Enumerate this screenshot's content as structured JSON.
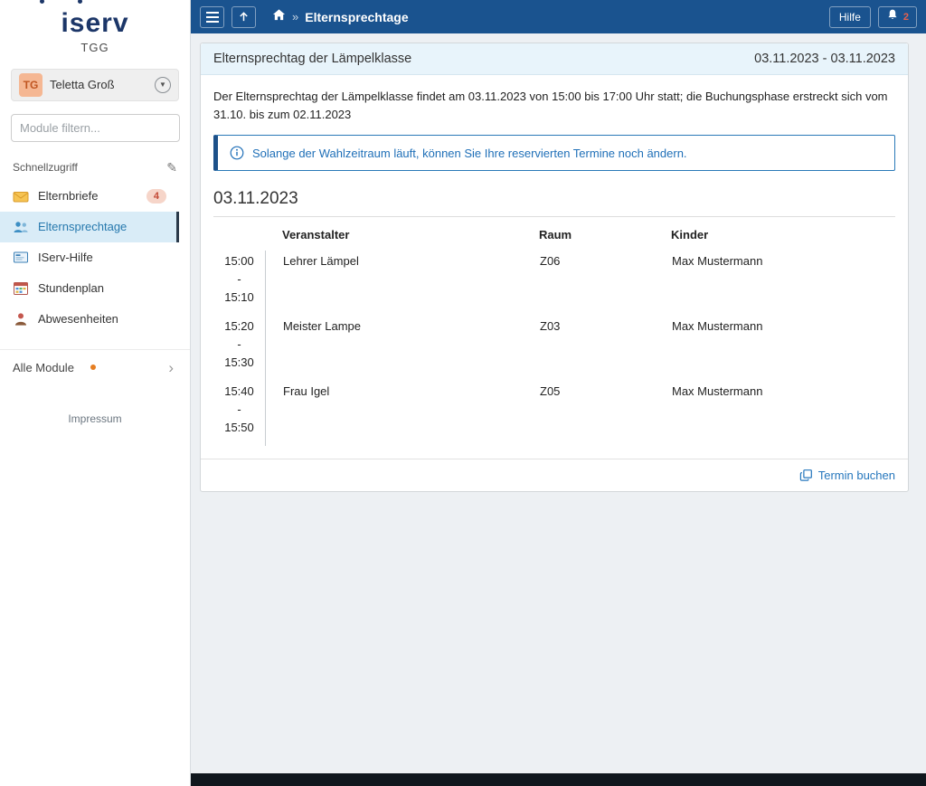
{
  "theme": {
    "header_bg": "#1a538f",
    "active_item_bg": "#d9ecf7",
    "link_color": "#2677bd",
    "alert_text": "#2070b8",
    "badge_bg": "#f6d5c9",
    "badge_text": "#c34a36",
    "footer_bar_bg": "#10171d"
  },
  "sidebar": {
    "logo_text": "iserv",
    "org_label": "TGG",
    "user": {
      "initials": "TG",
      "name": "Teletta Groß",
      "chevron_icon": "▼"
    },
    "filter_placeholder": "Module filtern...",
    "quick_access_label": "Schnellzugriff",
    "edit_icon": "✎",
    "items": [
      {
        "label": "Elternbriefe",
        "badge": "4",
        "icon": "letters-icon"
      },
      {
        "label": "Elternsprechtage",
        "icon": "people-icon"
      },
      {
        "label": "IServ-Hilfe",
        "icon": "help-screen-icon"
      },
      {
        "label": "Stundenplan",
        "icon": "timetable-icon"
      },
      {
        "label": "Abwesenheiten",
        "icon": "absence-icon"
      }
    ],
    "all_modules": {
      "label": "Alle Module",
      "chevron_icon": "›"
    },
    "impressum_label": "Impressum"
  },
  "header": {
    "breadcrumb_separator": "»",
    "title": "Elternsprechtage",
    "help_label": "Hilfe",
    "notification_count": "2"
  },
  "main": {
    "panel": {
      "title": "Elternsprechtag der Lämpelklasse",
      "date_range": "03.11.2023 - 03.11.2023",
      "description": "Der Elternsprechtag der Lämpelklasse findet am 03.11.2023 von 15:00 bis 17:00 Uhr statt; die Buchungsphase erstreckt sich vom 31.10. bis zum 02.11.2023",
      "info_alert": "Solange der Wahlzeitraum läuft, können Sie Ihre reservierten Termine noch ändern.",
      "day_heading": "03.11.2023",
      "table": {
        "time_separator": "-",
        "headers": {
          "veranstalter": "Veranstalter",
          "raum": "Raum",
          "kinder": "Kinder"
        },
        "rows": [
          {
            "time_start": "15:00",
            "time_end": "15:10",
            "veranstalter": "Lehrer Lämpel",
            "raum": "Z06",
            "kinder": "Max Mustermann"
          },
          {
            "time_start": "15:20",
            "time_end": "15:30",
            "veranstalter": "Meister Lampe",
            "raum": "Z03",
            "kinder": "Max Mustermann"
          },
          {
            "time_start": "15:40",
            "time_end": "15:50",
            "veranstalter": "Frau Igel",
            "raum": "Z05",
            "kinder": "Max Mustermann"
          }
        ]
      },
      "book_action_label": "Termin buchen"
    }
  }
}
